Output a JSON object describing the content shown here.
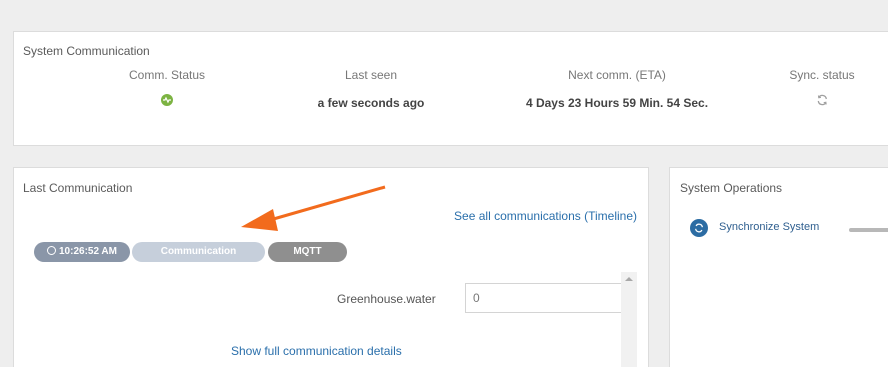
{
  "system_communication": {
    "title": "System Communication",
    "columns": {
      "comm_status": {
        "label": "Comm. Status",
        "status_color": "#7cb342"
      },
      "last_seen": {
        "label": "Last seen",
        "value": "a few seconds ago"
      },
      "next_comm": {
        "label": "Next comm. (ETA)",
        "value": "4 Days 23 Hours 59 Min. 54 Sec."
      },
      "sync_status": {
        "label": "Sync. status",
        "icon": "sync-icon"
      }
    }
  },
  "last_communication": {
    "title": "Last Communication",
    "timeline_link": "See all communications (Timeline)",
    "chips": {
      "time": "10:26:52 AM",
      "type": "Communication",
      "protocol": "MQTT"
    },
    "field": {
      "label": "Greenhouse.water",
      "value": "0"
    },
    "details_link": "Show full communication details"
  },
  "system_operations": {
    "title": "System Operations",
    "operations": [
      {
        "label": "Synchronize System",
        "icon": "sync-icon"
      }
    ]
  },
  "annotation": {
    "arrow_color": "#f26b1d"
  }
}
